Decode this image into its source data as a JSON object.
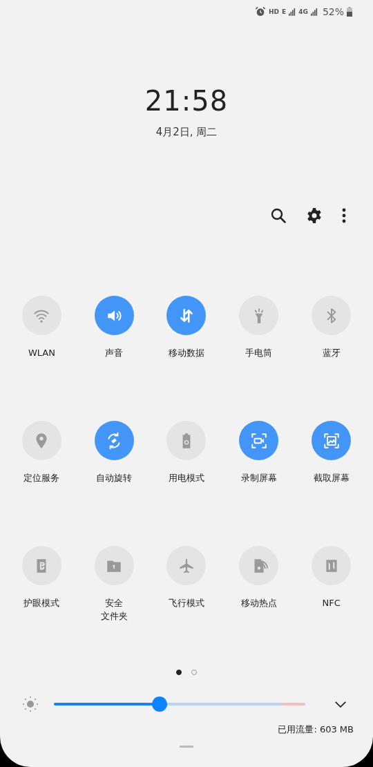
{
  "status_bar": {
    "hd": "HD",
    "network_1": "E",
    "network_2": "4G",
    "battery": "52%"
  },
  "clock": {
    "time": "21:58",
    "date": "4月2日, 周二"
  },
  "tiles": [
    {
      "label": "WLAN",
      "on": false
    },
    {
      "label": "声音",
      "on": true
    },
    {
      "label": "移动数据",
      "on": true
    },
    {
      "label": "手电筒",
      "on": false
    },
    {
      "label": "蓝牙",
      "on": false
    },
    {
      "label": "定位服务",
      "on": false
    },
    {
      "label": "自动旋转",
      "on": true
    },
    {
      "label": "用电模式",
      "on": false
    },
    {
      "label": "录制屏幕",
      "on": true
    },
    {
      "label": "截取屏幕",
      "on": true
    },
    {
      "label": "护眼模式",
      "on": false
    },
    {
      "label_lines": [
        "安全",
        "文件夹"
      ],
      "on": false
    },
    {
      "label": "飞行模式",
      "on": false
    },
    {
      "label": "移动热点",
      "on": false
    },
    {
      "label": "NFC",
      "on": false
    }
  ],
  "pages": [
    {
      "selected": true
    },
    {
      "selected": false
    }
  ],
  "brightness": {
    "level": 0.42
  },
  "data_usage": "已用流量: 603 MB"
}
